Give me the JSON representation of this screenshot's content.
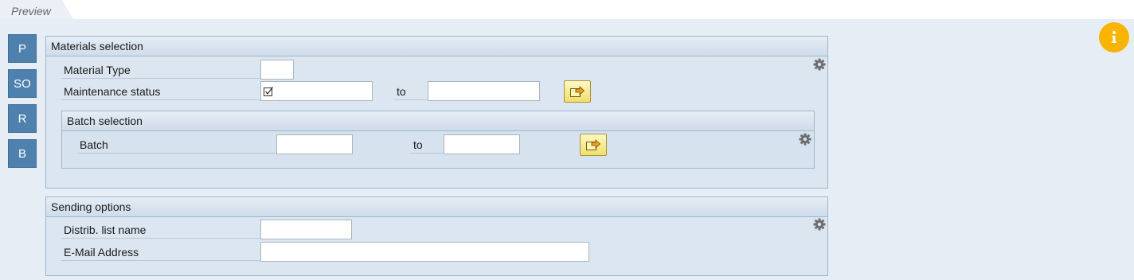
{
  "tab": {
    "label": "Preview"
  },
  "side_nav": [
    "P",
    "SO",
    "R",
    "B"
  ],
  "materials_selection": {
    "title": "Materials selection",
    "material_type_label": "Material Type",
    "maintenance_status_label": "Maintenance status",
    "maintenance_status_value": "",
    "to_label": "to",
    "batch_selection": {
      "title": "Batch selection",
      "batch_label": "Batch",
      "to_label": "to"
    }
  },
  "sending_options": {
    "title": "Sending options",
    "distrib_list_label": "Distrib. list name",
    "email_label": "E-Mail Address"
  },
  "colors": {
    "accent": "#4e81ad",
    "info": "#f7b500",
    "panel": "#dce6f0"
  },
  "icons": [
    "info-icon",
    "gear-icon",
    "multiple-selection-icon",
    "checkbox-icon"
  ]
}
